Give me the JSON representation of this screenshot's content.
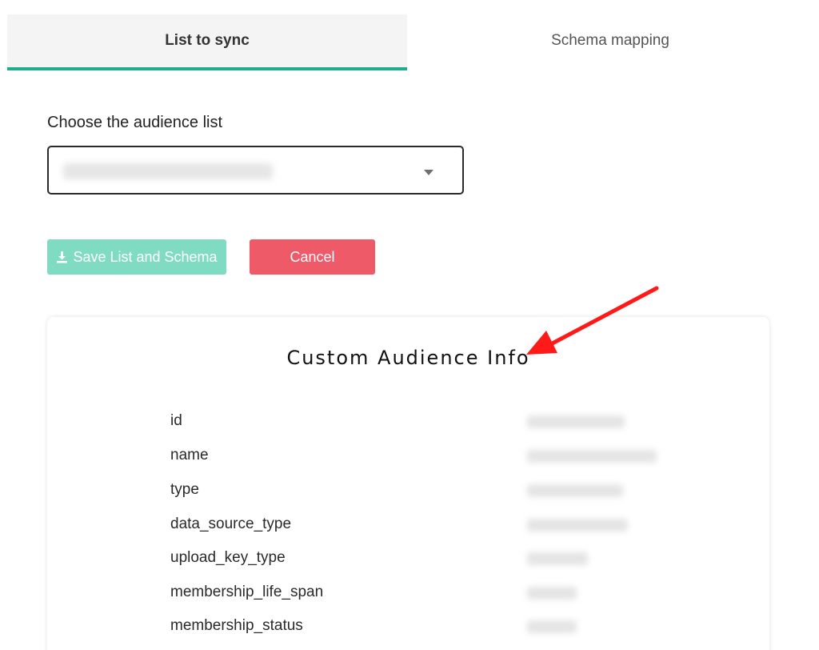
{
  "tabs": [
    {
      "label": "List to sync",
      "active": true
    },
    {
      "label": "Schema mapping",
      "active": false
    }
  ],
  "form": {
    "audience_label": "Choose the audience list",
    "audience_selected": ""
  },
  "buttons": {
    "save_label": "Save List and Schema",
    "cancel_label": "Cancel"
  },
  "card": {
    "title": "Custom Audience Info",
    "fields": [
      {
        "key": "id",
        "value": ""
      },
      {
        "key": "name",
        "value": ""
      },
      {
        "key": "type",
        "value": ""
      },
      {
        "key": "data_source_type",
        "value": ""
      },
      {
        "key": "upload_key_type",
        "value": ""
      },
      {
        "key": "membership_life_span",
        "value": ""
      },
      {
        "key": "membership_status",
        "value": ""
      }
    ]
  },
  "colors": {
    "accent": "#1fae8c",
    "save_button": "#7fdcc3",
    "cancel_button": "#ef5a69",
    "annotation_arrow": "#ff1a1a"
  },
  "icons": {
    "save": "download-icon",
    "dropdown": "caret-down-icon",
    "annotation": "arrow-annotation-icon"
  }
}
